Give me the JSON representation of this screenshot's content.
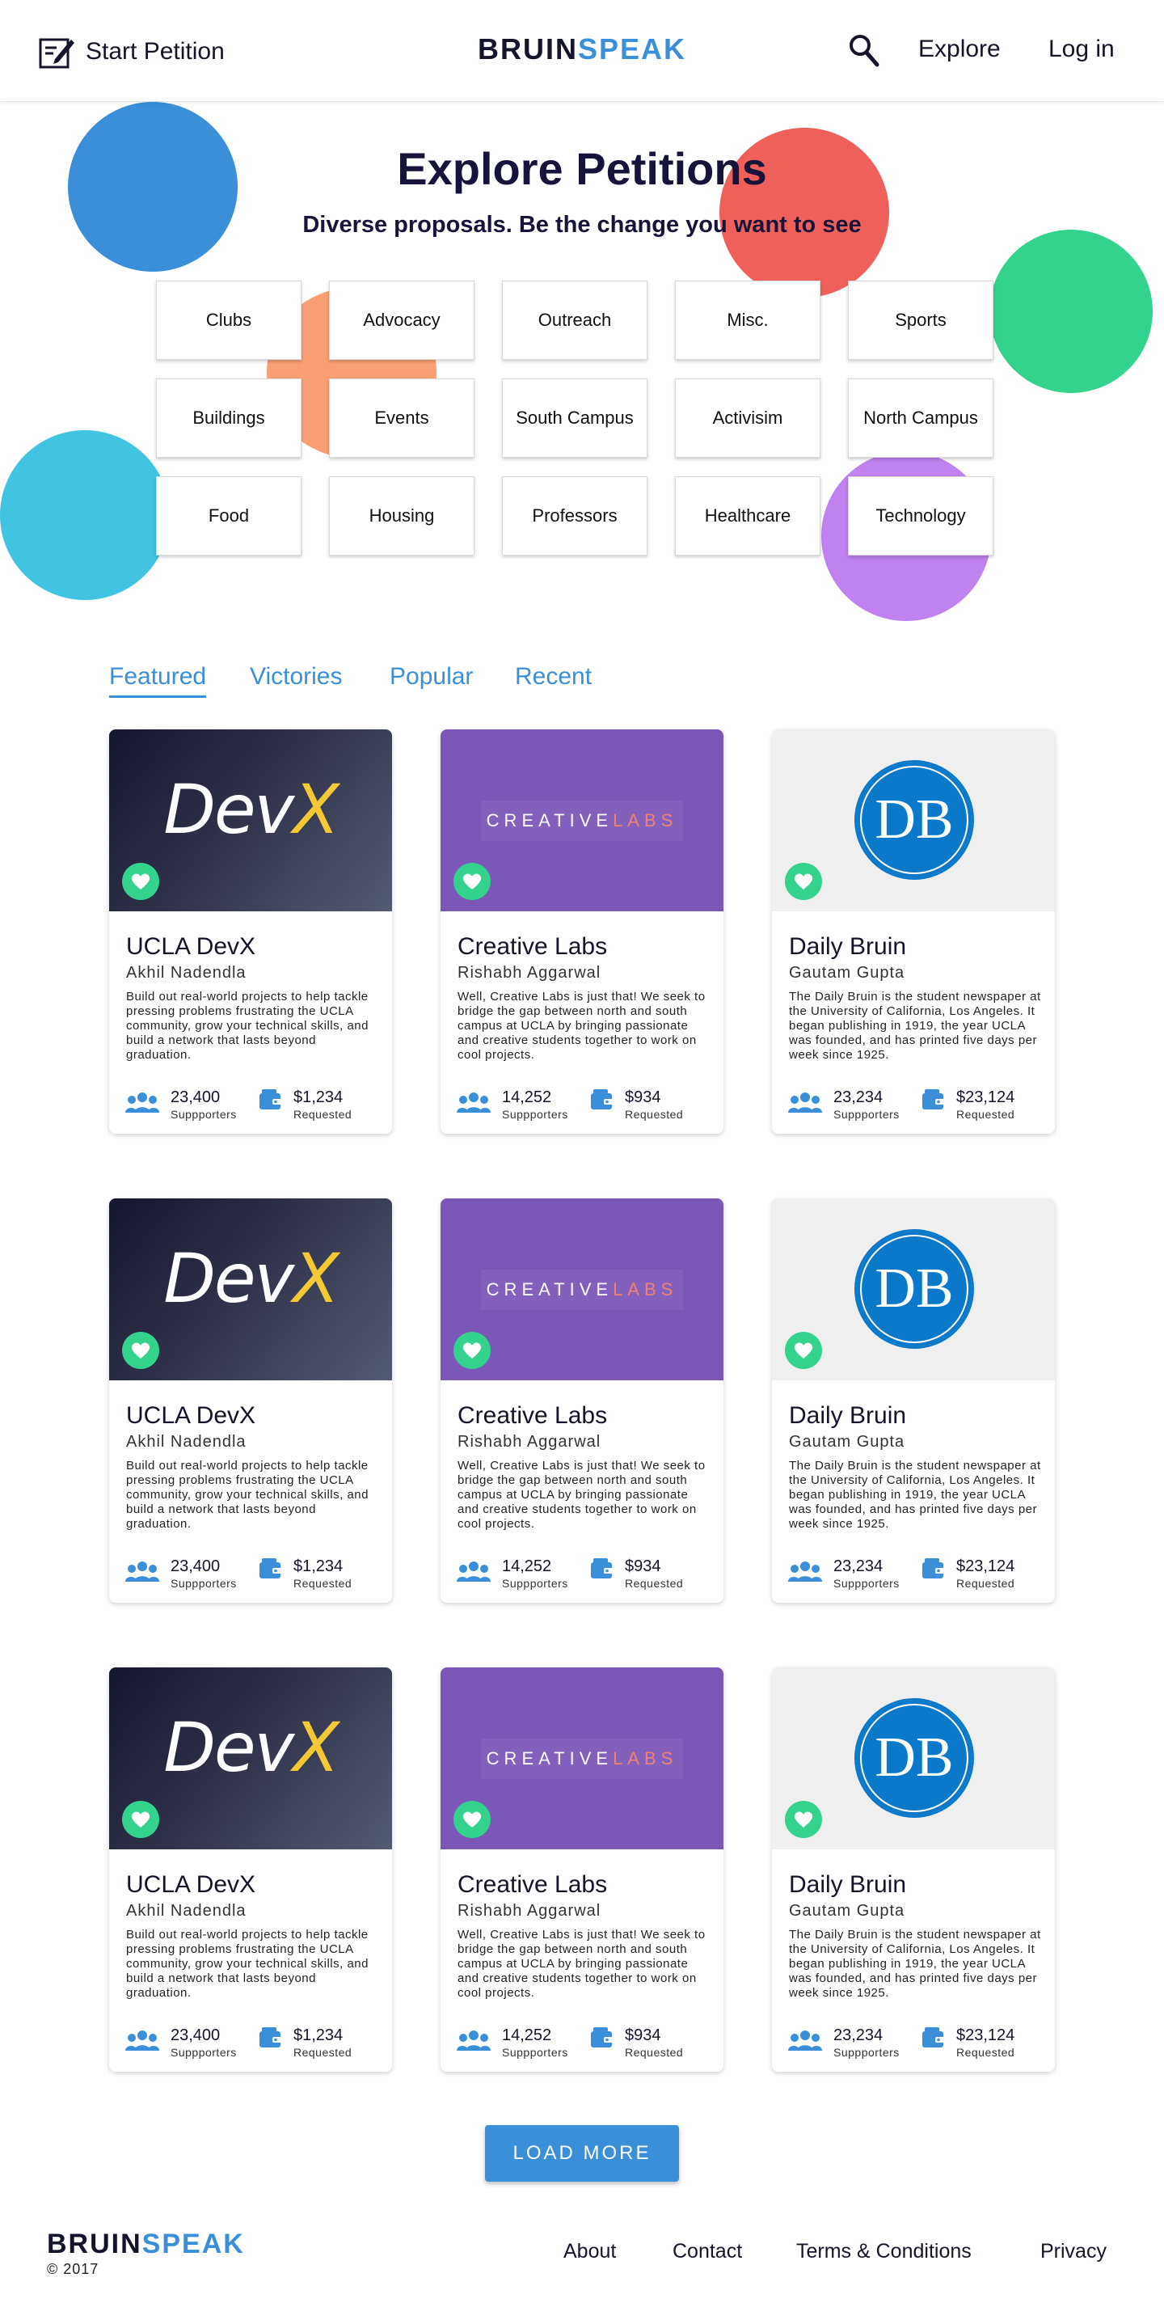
{
  "header": {
    "start_petition_label": "Start Petition",
    "logo_part1": "BRUIN",
    "logo_part2": "SPEAK",
    "explore_label": "Explore",
    "login_label": "Log in"
  },
  "hero": {
    "title": "Explore Petitions",
    "subtitle": "Diverse proposals. Be the change you want to see"
  },
  "categories": [
    "Clubs",
    "Advocacy",
    "Outreach",
    "Misc.",
    "Sports",
    "Buildings",
    "Events",
    "South Campus",
    "Activisim",
    "North Campus",
    "Food",
    "Housing",
    "Professors",
    "Healthcare",
    "Technology"
  ],
  "tabs": [
    "Featured",
    "Victories",
    "Popular",
    "Recent"
  ],
  "active_tab": "Featured",
  "cards": [
    {
      "logo": {
        "part1": "Dev",
        "part2": "X"
      },
      "title": "UCLA DevX",
      "author": "Akhil Nadendla",
      "description": "Build out real-world projects to help tackle pressing problems frustrating the UCLA community, grow your technical skills, and build a network that lasts beyond graduation.",
      "supporters": "23,400",
      "supporters_label": "Suppporters",
      "amount": "$1,234",
      "amount_label": "Requested"
    },
    {
      "logo": {
        "part1": "CREATIVE",
        "part2": "LABS"
      },
      "title": "Creative Labs",
      "author": "Rishabh Aggarwal",
      "description": "Well, Creative Labs is just that! We seek to bridge the gap between north and south campus at UCLA by bringing passionate and creative students together to work on cool projects.",
      "supporters": "14,252",
      "supporters_label": "Suppporters",
      "amount": "$934",
      "amount_label": "Requested"
    },
    {
      "logo": {
        "part1": "DB"
      },
      "title": "Daily Bruin",
      "author": "Gautam Gupta",
      "description": "The Daily Bruin is the student newspaper at the University of California, Los Angeles. It began publishing in 1919, the year UCLA was founded, and has printed five days per week since 1925.",
      "supporters": "23,234",
      "supporters_label": "Suppporters",
      "amount": "$23,124",
      "amount_label": "Requested"
    }
  ],
  "load_more_label": "LOAD MORE",
  "footer": {
    "logo_part1": "BRUIN",
    "logo_part2": "SPEAK",
    "copyright": "© 2017",
    "links": [
      "About",
      "Contact",
      "Terms & Conditions",
      "Privacy"
    ]
  },
  "colors": {
    "accent": "#3a8fd8",
    "heart": "#34d38d",
    "circle_blue": "#3a8fd8",
    "circle_red": "#ef605a",
    "circle_green": "#34d38d",
    "circle_cyan": "#40c4e1",
    "circle_purple": "#bf82ef",
    "circle_orange": "#f99f74"
  }
}
